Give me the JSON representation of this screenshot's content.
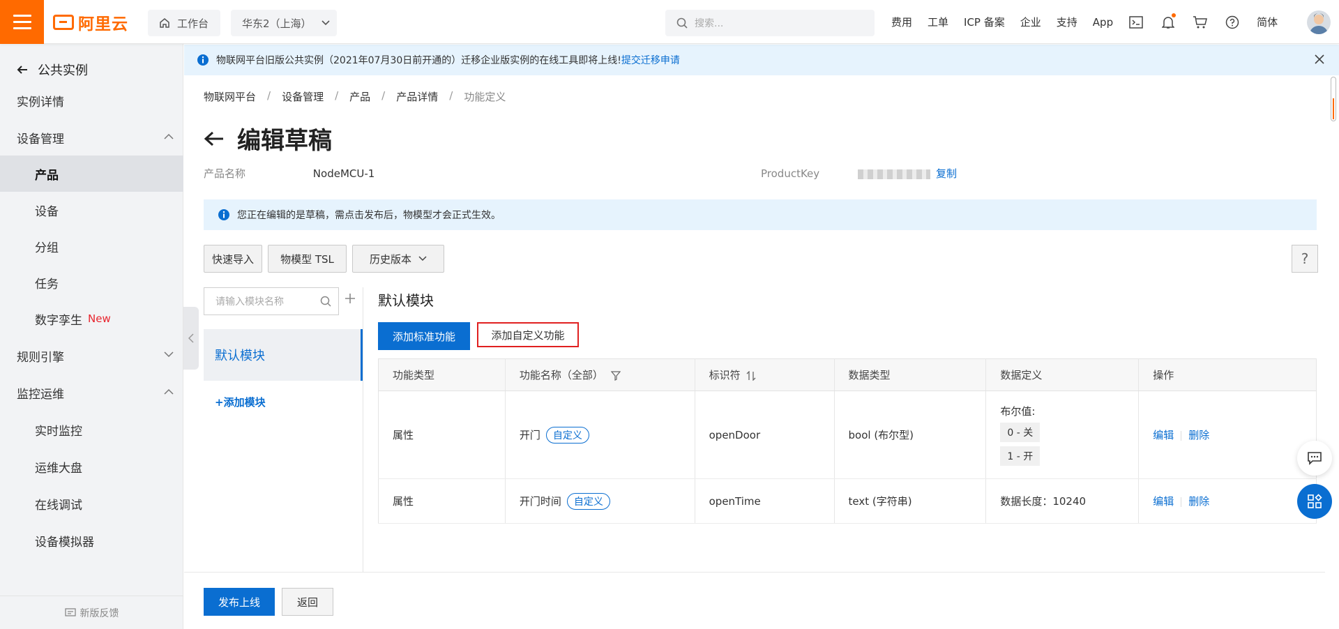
{
  "topbar": {
    "logo_text": "阿里云",
    "workbench": "工作台",
    "region": "华东2（上海）",
    "search_placeholder": "搜索...",
    "links": [
      "费用",
      "工单",
      "ICP 备案",
      "企业",
      "支持",
      "App"
    ],
    "lang": "简体"
  },
  "sidebar": {
    "back_label": "公共实例",
    "items": [
      {
        "label": "实例详情"
      },
      {
        "label": "设备管理"
      },
      {
        "label": "产品"
      },
      {
        "label": "设备"
      },
      {
        "label": "分组"
      },
      {
        "label": "任务"
      },
      {
        "label": "数字孪生",
        "tag": "New"
      },
      {
        "label": "规则引擎"
      },
      {
        "label": "监控运维"
      },
      {
        "label": "实时监控"
      },
      {
        "label": "运维大盘"
      },
      {
        "label": "在线调试"
      },
      {
        "label": "设备模拟器"
      }
    ],
    "feedback": "新版反馈"
  },
  "notice": {
    "text": "物联网平台旧版公共实例（2021年07月30日前开通的）迁移企业版实例的在线工具即将上线!",
    "link": "提交迁移申请"
  },
  "breadcrumb": [
    "物联网平台",
    "设备管理",
    "产品",
    "产品详情",
    "功能定义"
  ],
  "page": {
    "title": "编辑草稿",
    "product_name_label": "产品名称",
    "product_name": "NodeMCU-1",
    "product_key_label": "ProductKey",
    "copy": "复制",
    "draft_tip": "您正在编辑的是草稿，需点击发布后，物模型才会正式生效。"
  },
  "toolbar": {
    "quick_import": "快速导入",
    "tsl": "物模型 TSL",
    "history": "历史版本"
  },
  "modules": {
    "search_placeholder": "请输入模块名称",
    "default_module": "默认模块",
    "add_module": "+添加模块",
    "title": "默认模块",
    "add_standard": "添加标准功能",
    "add_custom": "添加自定义功能"
  },
  "table": {
    "headers": [
      "功能类型",
      "功能名称（全部）",
      "标识符",
      "数据类型",
      "数据定义",
      "操作"
    ],
    "rows": [
      {
        "type": "属性",
        "name": "开门",
        "tag": "自定义",
        "identifier": "openDoor",
        "data_type": "bool (布尔型)",
        "def_label": "布尔值:",
        "def_values": [
          "0 - 关",
          "1 - 开"
        ],
        "edit": "编辑",
        "delete": "删除"
      },
      {
        "type": "属性",
        "name": "开门时间",
        "tag": "自定义",
        "identifier": "openTime",
        "data_type": "text (字符串)",
        "def_text": "数据长度：10240",
        "edit": "编辑",
        "delete": "删除"
      }
    ]
  },
  "footer": {
    "publish": "发布上线",
    "back": "返回"
  },
  "colors": {
    "brand": "#ff6a00",
    "primary": "#0a6ed1",
    "highlight": "#e02020"
  }
}
